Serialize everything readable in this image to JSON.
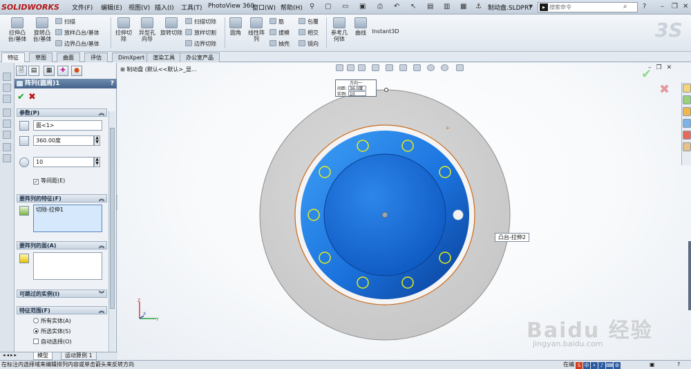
{
  "titlebar": {
    "logo": "SOLIDWORKS",
    "menus": [
      "文件(F)",
      "编辑(E)",
      "视图(V)",
      "插入(I)",
      "工具(T)",
      "PhotoView 360",
      "窗口(W)",
      "帮助(H)"
    ],
    "doc_title": "制动盘.SLDPRT",
    "search_placeholder": "搜索命令"
  },
  "command_manager": {
    "big_tools": [
      "拉伸凸台/基体",
      "旋转凸台/基体",
      "拉伸切除",
      "异型孔向导",
      "旋转切除",
      "圆角",
      "线性阵列",
      "参考几何体",
      "曲线",
      "Instant3D"
    ],
    "small_tools": {
      "features_col1": [
        "扫描",
        "放样凸台/基体",
        "边界凸台/基体"
      ],
      "cut_col": [
        "扫描切除",
        "放样切割",
        "边界切除"
      ],
      "misc_col1": [
        "筋",
        "拔模",
        "抽壳"
      ],
      "misc_col2": [
        "包覆",
        "相交",
        "镜向"
      ]
    }
  },
  "tabs": [
    "特征",
    "草图",
    "曲面",
    "评估",
    "DimXpert",
    "渲染工具",
    "办公室产品"
  ],
  "active_tab": "特征",
  "property_manager": {
    "title": "阵列(圆周)1",
    "help": "?",
    "params": {
      "header": "参数(P)",
      "axis": "面<1>",
      "angle": "360.00度",
      "instances": "10",
      "equal_spacing": "等间距(E)",
      "equal_spacing_checked": true
    },
    "features_to_pattern": {
      "header": "要阵列的特征(F)",
      "items": [
        "切除-拉伸1"
      ]
    },
    "faces_to_pattern": {
      "header": "要阵列的面(A)"
    },
    "skip_instances": {
      "header": "可跳过的实例(I)"
    },
    "feature_scope": {
      "header": "特征范围(F)",
      "options": [
        "所有实体(A)",
        "所选实体(S)"
      ],
      "selected_option": "所选实体(S)",
      "auto_select": "自动选择(O)",
      "auto_select_checked": false
    }
  },
  "bottom_tabs": [
    "模型",
    "运动算例 1"
  ],
  "status": {
    "text": "在标注内选择域来编辑排列内容或单击箭头来反转方向",
    "right": "在编"
  },
  "viewport": {
    "tree_line": "制动盘 (默认<<默认>_显...",
    "callout": {
      "title": "方向一",
      "spacing_label": "间距:",
      "spacing_value": "36.0度",
      "count_label": "实例:",
      "count_value": "10"
    },
    "feature_tag": "凸台-拉伸2",
    "triad": {
      "x": "X",
      "y": "Y",
      "z": "Z"
    },
    "watermark": "Baidu 经验",
    "watermark_url": "jingyan.baidu.com"
  },
  "colors": {
    "outer_disk": "#d2d2d2",
    "hub_blue": "#1b73de",
    "hub_dark": "#0c4fb0",
    "hole_outline": "#e4ef1a",
    "accent_orange": "#c96a1a"
  }
}
